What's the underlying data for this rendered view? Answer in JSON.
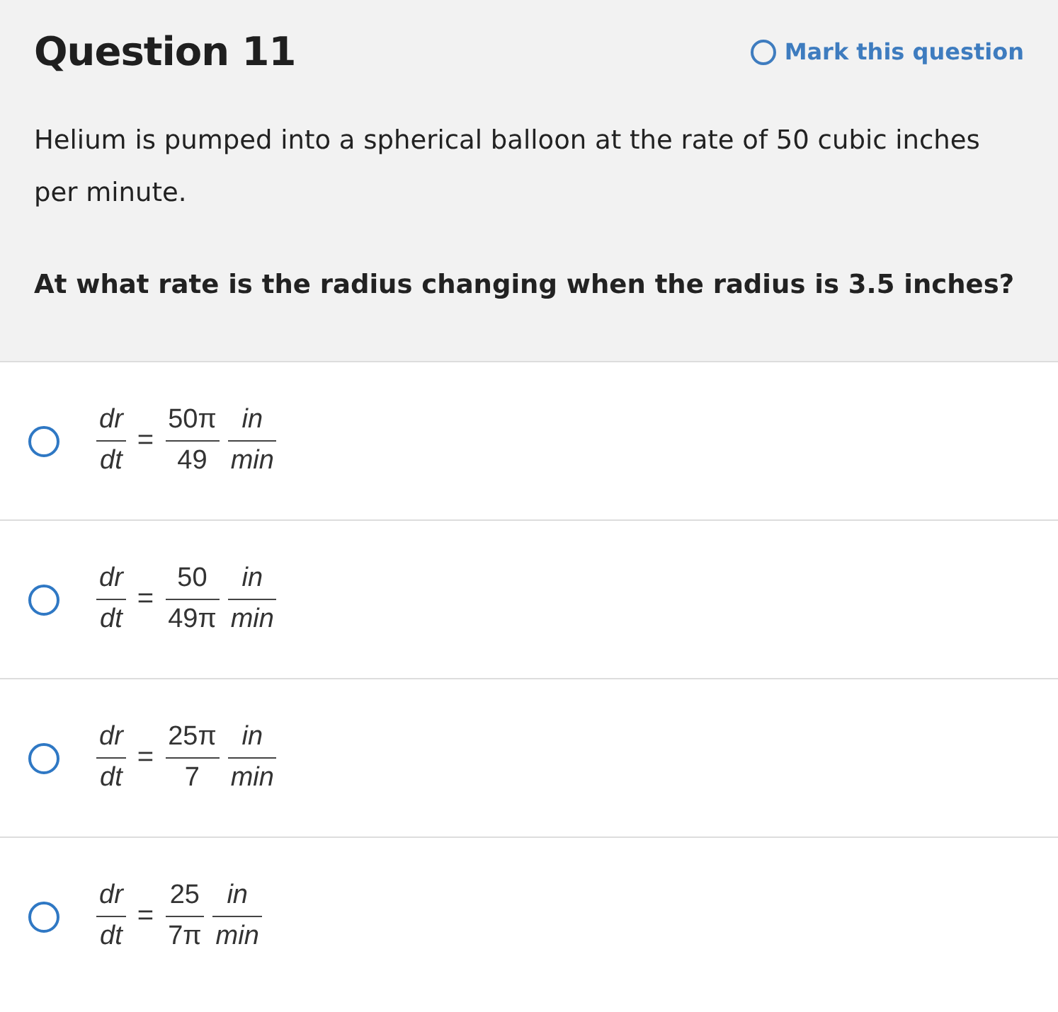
{
  "question": {
    "title": "Question 11",
    "mark_question": {
      "label": "Mark this question",
      "checked": false
    },
    "stem": "Helium is pumped into a spherical balloon at the rate of 50 cubic inches per minute.",
    "prompt": "At what rate is the radius changing when the radius is 3.5 inches?"
  },
  "options": [
    {
      "selected": false,
      "lhs": {
        "num": "dr",
        "den": "dt"
      },
      "equals": "=",
      "value": {
        "num": "50π",
        "den": "49"
      },
      "unit": {
        "num": "in",
        "den": "min"
      }
    },
    {
      "selected": false,
      "lhs": {
        "num": "dr",
        "den": "dt"
      },
      "equals": "=",
      "value": {
        "num": "50",
        "den": "49π"
      },
      "unit": {
        "num": "in",
        "den": "min"
      }
    },
    {
      "selected": false,
      "lhs": {
        "num": "dr",
        "den": "dt"
      },
      "equals": "=",
      "value": {
        "num": "25π",
        "den": "7"
      },
      "unit": {
        "num": "in",
        "den": "min"
      }
    },
    {
      "selected": false,
      "lhs": {
        "num": "dr",
        "den": "dt"
      },
      "equals": "=",
      "value": {
        "num": "25",
        "den": "7π"
      },
      "unit": {
        "num": "in",
        "den": "min"
      }
    }
  ]
}
